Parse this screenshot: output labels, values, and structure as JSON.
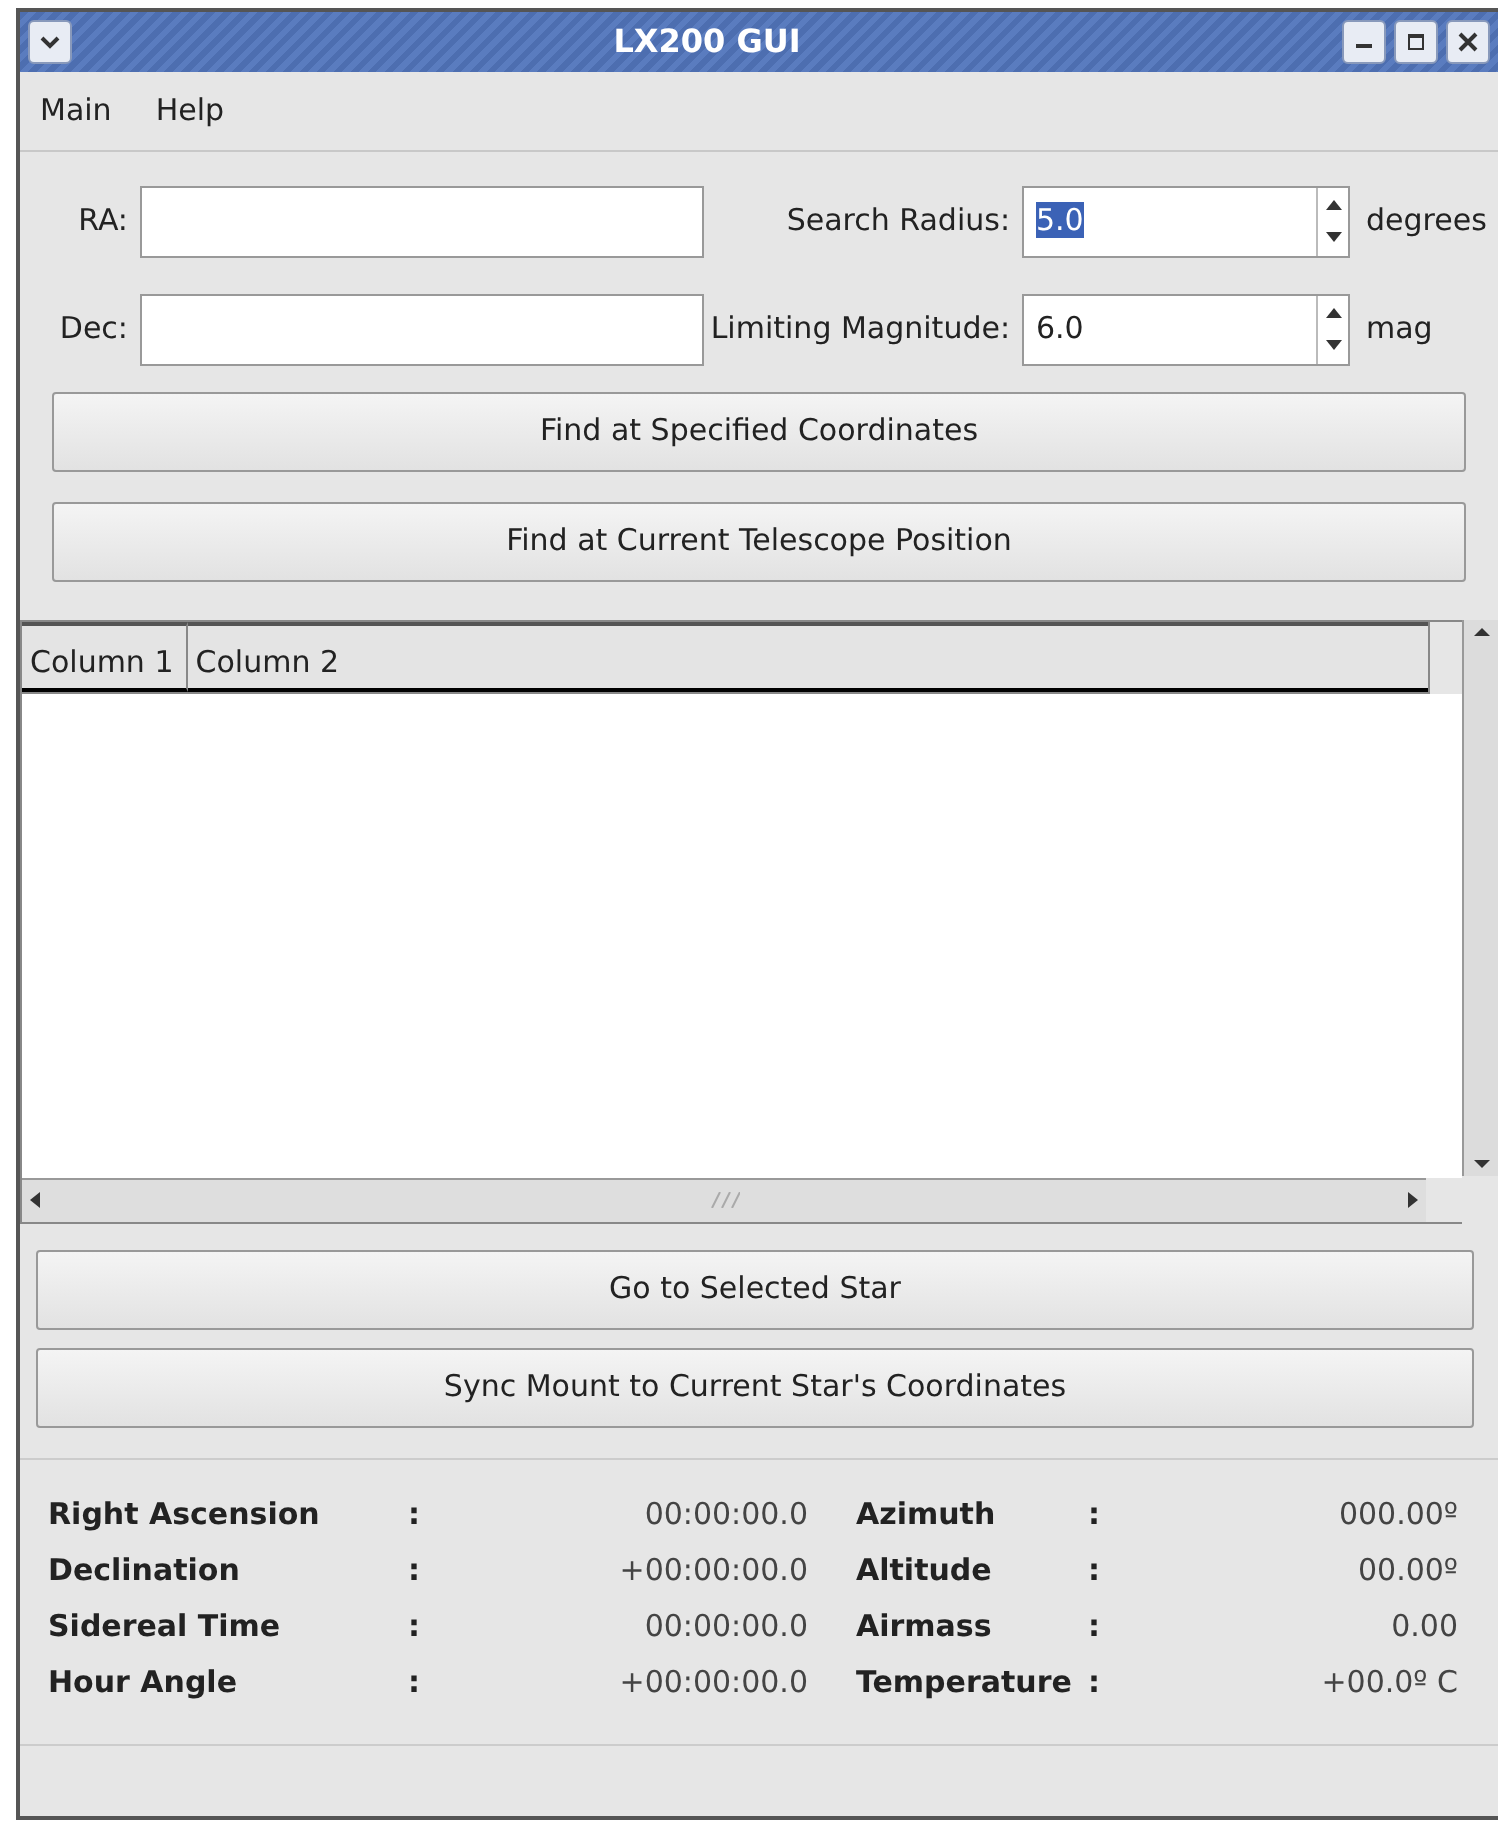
{
  "window": {
    "title": "LX200 GUI"
  },
  "menu": [
    "Main",
    "Help"
  ],
  "fields": [
    {
      "label": "RA:"
    },
    {
      "label": "Dec:"
    }
  ],
  "spinners": [
    {
      "label": "Search Radius:",
      "value": "5.0",
      "unit": "degrees",
      "highlighted": true
    },
    {
      "label": "Limiting Magnitude:",
      "value": "6.0",
      "unit": "mag",
      "highlighted": false
    }
  ],
  "find_buttons": [
    "Find at Specified Coordinates",
    "Find at Current Telescope Position"
  ],
  "table": {
    "columns": [
      "Column 1",
      "Column 2"
    ]
  },
  "action_buttons": [
    "Go to Selected Star",
    "Sync Mount to Current Star's Coordinates"
  ],
  "status": [
    {
      "label": "Right Ascension",
      "sep": ":",
      "value": "00:00:00.0",
      "label_2": "Azimuth",
      "sep_2": ":",
      "value_2": "000.00º"
    },
    {
      "label": "Declination",
      "sep": ":",
      "value": "+00:00:00.0",
      "label_2": "Altitude",
      "sep_2": ":",
      "value_2": "00.00º"
    },
    {
      "label": "Sidereal Time",
      "sep": ":",
      "value": "00:00:00.0",
      "label_2": "Airmass",
      "sep_2": ":",
      "value_2": "0.00"
    },
    {
      "label": "Hour Angle",
      "sep": ":",
      "value": "+00:00:00.0",
      "label_2": "Temperature",
      "sep_2": ":",
      "value_2": "+00.0º C"
    }
  ]
}
